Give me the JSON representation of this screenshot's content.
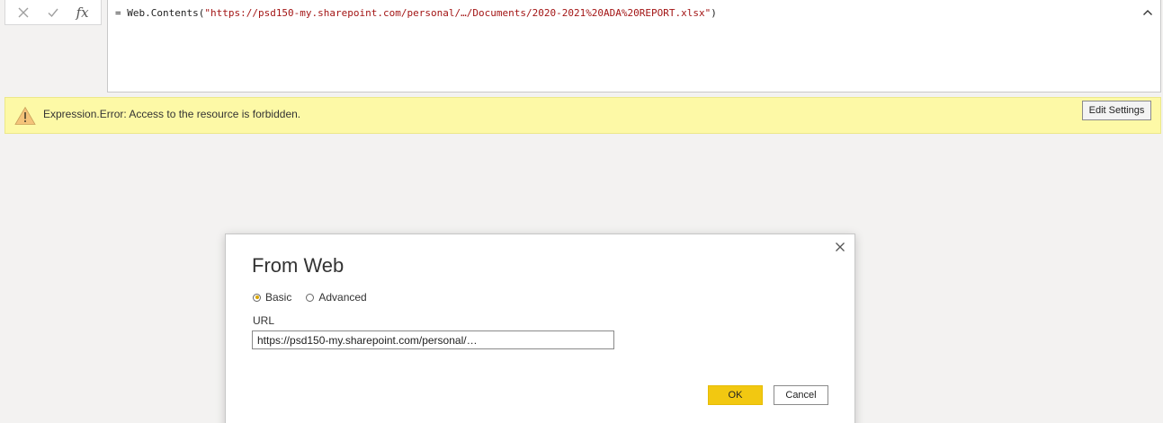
{
  "formula_bar": {
    "fx_label": "fx",
    "prefix": "= Web.Contents(",
    "url_string": "\"https://psd150-my.sharepoint.com/personal/…/Documents/2020-2021%20ADA%20REPORT.xlsx\"",
    "suffix": ")"
  },
  "error_banner": {
    "message": "Expression.Error: Access to the resource is forbidden.",
    "edit_settings_label": "Edit Settings"
  },
  "dialog": {
    "title": "From Web",
    "radio_basic_label": "Basic",
    "radio_advanced_label": "Advanced",
    "selected_mode": "Basic",
    "url_label": "URL",
    "url_value": "https://psd150-my.sharepoint.com/personal/…",
    "ok_label": "OK",
    "cancel_label": "Cancel"
  },
  "colors": {
    "accent_yellow": "#f2c811",
    "error_banner_bg": "#fdf9a6",
    "formula_string": "#a31515",
    "background": "#f3f2f1"
  }
}
